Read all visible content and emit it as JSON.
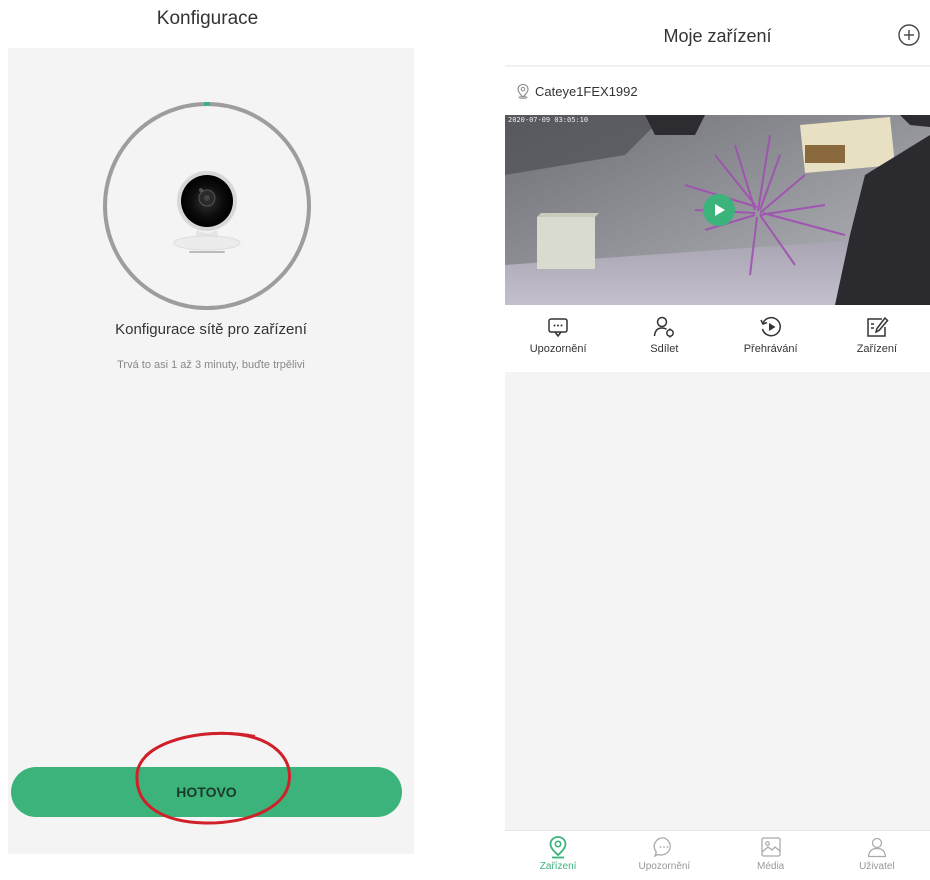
{
  "left_screen": {
    "title": "Konfigurace",
    "heading": "Konfigurace sítě pro zařízení",
    "subtext": "Trvá to asi 1 až 3 minuty, buďte trpělivi",
    "done_button": "HOTOVO",
    "progress_fraction": 0.0,
    "colors": {
      "accent": "#3cb37b",
      "annotation": "#d0202a"
    }
  },
  "right_screen": {
    "title": "Moje zařízení",
    "add_icon": "plus-circle-icon",
    "device": {
      "name": "Cateye1FEX1992",
      "location_icon": "location-pin-icon",
      "video_timestamp": "2020-07-09  03:05:10",
      "play_icon": "play-icon"
    },
    "actions": [
      {
        "label": "Upozornění",
        "icon": "chat-bubble-icon"
      },
      {
        "label": "Sdílet",
        "icon": "share-user-icon"
      },
      {
        "label": "Přehrávání",
        "icon": "playback-icon"
      },
      {
        "label": "Zařízení",
        "icon": "edit-device-icon"
      }
    ],
    "tabs": [
      {
        "label": "Zařízení",
        "icon": "location-pin-icon",
        "active": true
      },
      {
        "label": "Upozornění",
        "icon": "chat-bubble-icon",
        "active": false
      },
      {
        "label": "Média",
        "icon": "image-icon",
        "active": false
      },
      {
        "label": "Uživatel",
        "icon": "user-icon",
        "active": false
      }
    ]
  }
}
